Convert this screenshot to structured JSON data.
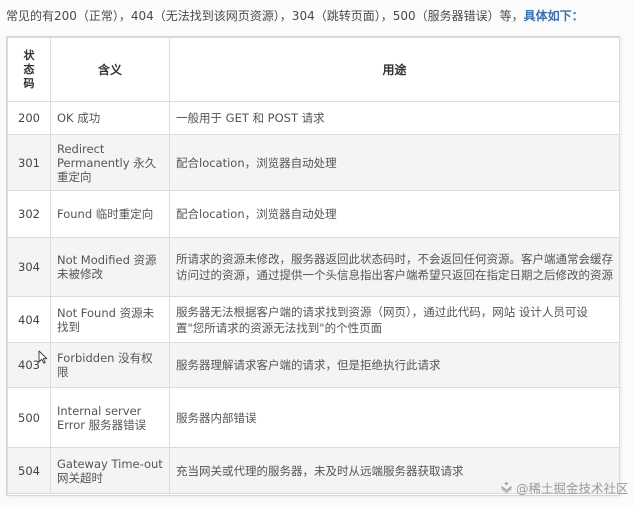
{
  "intro": {
    "text": "常见的有200（正常），404（无法找到该网页资源），304（跳转页面），500（服务器错误）等，",
    "emphasis": "具体如下："
  },
  "table": {
    "headers": {
      "code": "状态码",
      "meaning": "含义",
      "usage": "用途"
    },
    "rows": [
      {
        "code": "200",
        "meaning": "OK 成功",
        "usage": "一般用于 GET 和 POST 请求"
      },
      {
        "code": "301",
        "meaning": "Redirect Permanently 永久重定向",
        "usage": "配合location，浏览器自动处理"
      },
      {
        "code": "302",
        "meaning": "Found 临时重定向",
        "usage": "配合location，浏览器自动处理"
      },
      {
        "code": "304",
        "meaning": "Not Modified 资源未被修改",
        "usage": "所请求的资源未修改，服务器返回此状态码时，不会返回任何资源。客户端通常会缓存访问过的资源，通过提供一个头信息指出客户端希望只返回在指定日期之后修改的资源"
      },
      {
        "code": "404",
        "meaning": "Not Found 资源未找到",
        "usage": "服务器无法根据客户端的请求找到资源（网页），通过此代码，网站 设计人员可设置\"您所请求的资源无法找到\"的个性页面"
      },
      {
        "code": "403",
        "meaning": "Forbidden 没有权限",
        "usage": "服务器理解请求客户端的请求，但是拒绝执行此请求"
      },
      {
        "code": "500",
        "meaning": "Internal server Error 服务器错误",
        "usage": "服务器内部错误"
      },
      {
        "code": "504",
        "meaning": "Gateway Time-out网关超时",
        "usage": "充当网关或代理的服务器，未及时从远端服务器获取请求"
      }
    ]
  },
  "watermark": {
    "text": "@稀土掘金技术社区",
    "icon": "juejin-logo-icon"
  },
  "colors": {
    "emphasis": "#3a6fb0",
    "row_alt": "#f4f4f4",
    "border": "#dcdcdc"
  }
}
